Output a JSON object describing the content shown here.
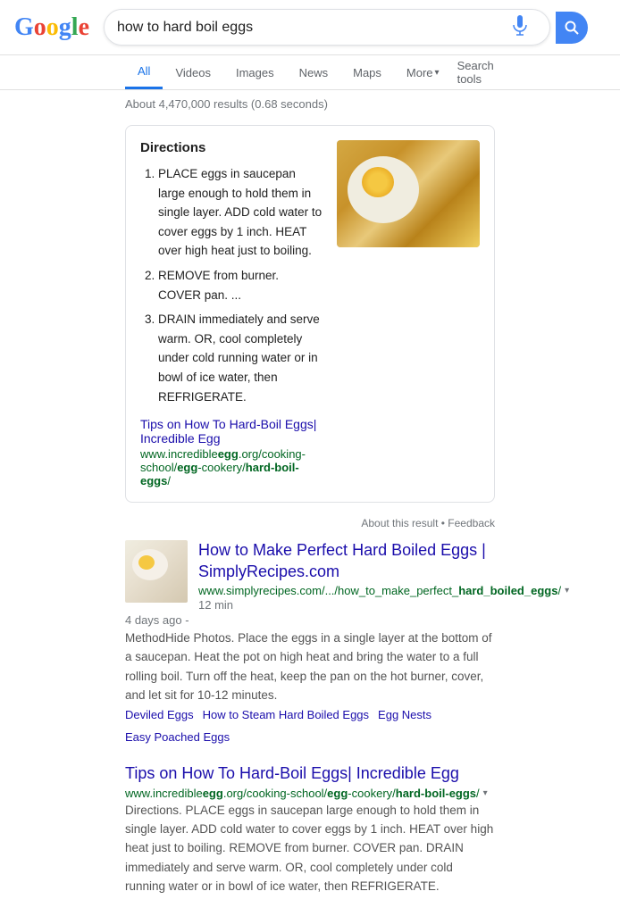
{
  "header": {
    "logo_letters": [
      "G",
      "o",
      "o",
      "g",
      "l",
      "e"
    ],
    "search_query": "how to hard boil eggs",
    "mic_label": "microphone",
    "search_button_label": "search"
  },
  "nav": {
    "items": [
      {
        "label": "All",
        "active": true
      },
      {
        "label": "Videos",
        "active": false
      },
      {
        "label": "Images",
        "active": false
      },
      {
        "label": "News",
        "active": false
      },
      {
        "label": "Maps",
        "active": false
      },
      {
        "label": "More",
        "active": false
      }
    ],
    "tools_label": "Search tools"
  },
  "results_count": "About 4,470,000 results (0.68 seconds)",
  "featured_snippet": {
    "title": "Directions",
    "steps": [
      "PLACE eggs in saucepan large enough to hold them in single layer. ADD cold water to cover eggs by 1 inch. HEAT over high heat just to boiling.",
      "REMOVE from burner. COVER pan. ...",
      "DRAIN immediately and serve warm. OR, cool completely under cold running water or in bowl of ice water, then REFRIGERATE."
    ],
    "link_text": "Tips on How To Hard-Boil Eggs| Incredible Egg",
    "url_prefix": "www.incredible",
    "url_bold": "egg",
    "url_suffix": ".org/cooking-school/",
    "url_bold2": "egg",
    "url_suffix2": "-cookery/",
    "url_bold3": "hard-boil-eggs",
    "url_suffix3": "/",
    "about_text": "About this result",
    "feedback_text": "Feedback"
  },
  "results": [
    {
      "title": "How to Make Perfect Hard Boiled Eggs | SimplyRecipes.com",
      "url_prefix": "www.simplyrecipes.com/.../how_to_make_perfect_",
      "url_bold": "hard_boiled_eggs",
      "url_suffix": "/",
      "has_thumbnail": true,
      "meta": "12 min",
      "meta2": "4 days ago -",
      "snippet": "MethodHide Photos. Place the eggs in a single layer at the bottom of a saucepan. Heat the pot on high heat and bring the water to a full rolling boil. Turn off the heat, keep the pan on the hot burner, cover, and let sit for 10-12 minutes.",
      "related": [
        "Deviled Eggs",
        "How to Steam Hard Boiled Eggs",
        "Egg Nests",
        "Easy Poached Eggs"
      ]
    },
    {
      "title": "Tips on How To Hard-Boil Eggs| Incredible Egg",
      "url_prefix": "www.incredible",
      "url_bold": "egg",
      "url_suffix": ".org/cooking-school/",
      "url_bold2": "egg",
      "url_suffix2": "-cookery/",
      "url_bold3": "hard-boil-eggs",
      "url_suffix3": "/",
      "has_thumbnail": false,
      "snippet": "Directions. PLACE eggs in saucepan large enough to hold them in single layer. ADD cold water to cover eggs by 1 inch. HEAT over high heat just to boiling. REMOVE from burner. COVER pan. DRAIN immediately and serve warm. OR, cool completely under cold running water or in bowl of ice water, then REFRIGERATE."
    }
  ]
}
